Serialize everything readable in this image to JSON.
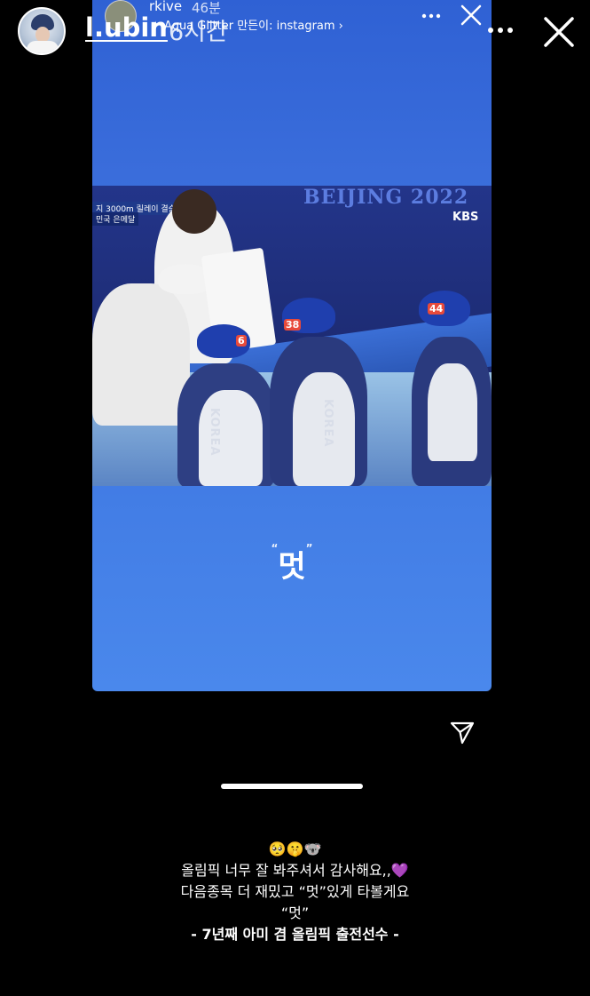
{
  "story": {
    "username": "l.ubin",
    "time": "6시간",
    "more_icon": "more-horizontal-icon",
    "close_icon": "close-icon"
  },
  "repost": {
    "username": "rkive",
    "time": "46분",
    "effect_label": "✦ Aqua Glitter 만든이: instagram ›",
    "caption_text": "멋",
    "photo": {
      "broadcast_caption": "지 3000m 릴레이 결승",
      "broadcast_medal": "민국  은메달",
      "venue_text": "BEIJING 2022",
      "channel_logo": "KBS",
      "bib_numbers": [
        "44",
        "38",
        "6"
      ],
      "jersey_text": "KOREA"
    }
  },
  "share_icon": "send-icon",
  "caption": {
    "emoji": "🥺🤫🐨",
    "line1": "올림픽 너무 잘 봐주셔서 감사해요,,💜",
    "line2": "다음종목 더 재밌고 “멋”있게 타볼게요",
    "line3": "“멋”",
    "line4": "- 7년째 아미 겸 올림픽 출전선수 -"
  },
  "colors": {
    "background": "#000000",
    "card_blue": "#3a6ddb",
    "text": "#ffffff"
  }
}
